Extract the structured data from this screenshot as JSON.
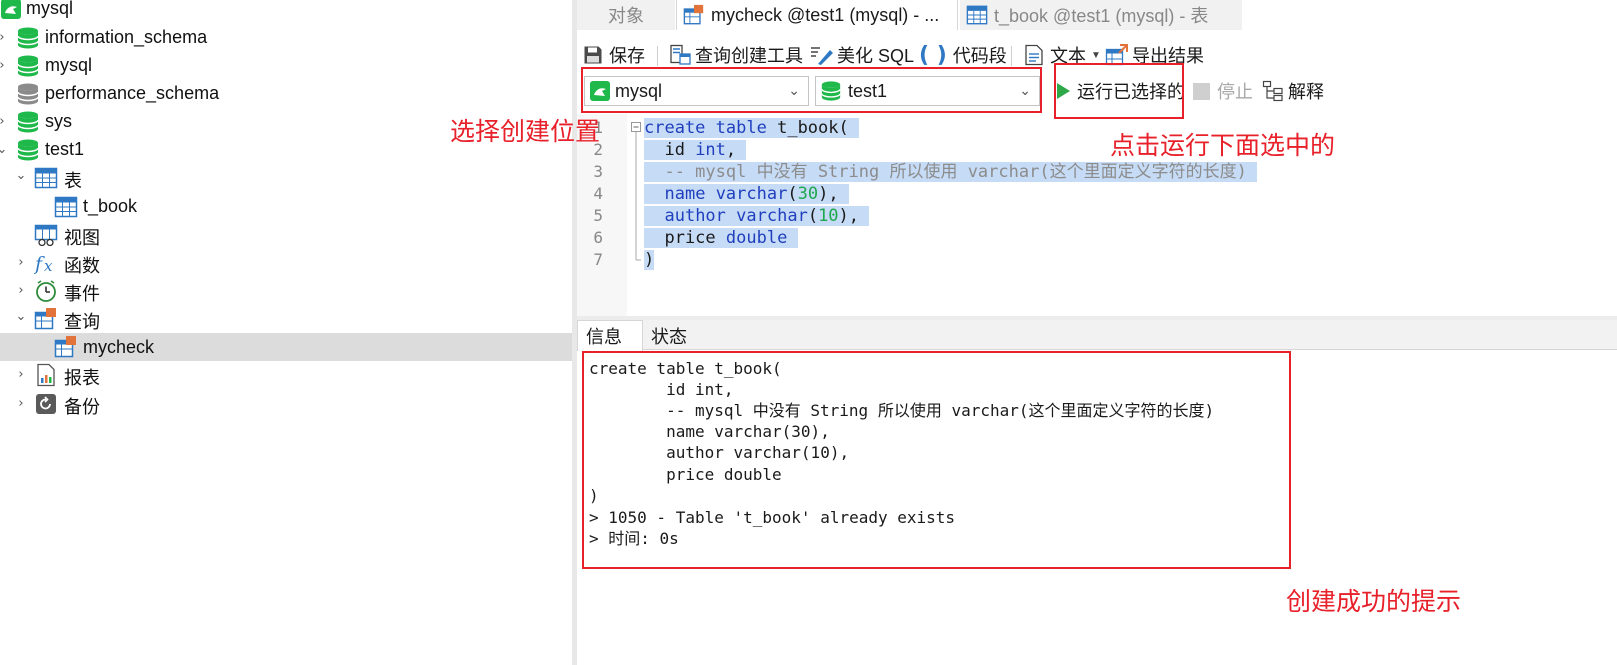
{
  "tree": {
    "items": [
      {
        "label": "mysql"
      },
      {
        "label": "information_schema"
      },
      {
        "label": "mysql"
      },
      {
        "label": "performance_schema"
      },
      {
        "label": "sys"
      },
      {
        "label": "test1"
      },
      {
        "label": "表"
      },
      {
        "label": "t_book"
      },
      {
        "label": "视图"
      },
      {
        "label": "函数"
      },
      {
        "label": "事件"
      },
      {
        "label": "查询"
      },
      {
        "label": "mycheck"
      },
      {
        "label": "报表"
      },
      {
        "label": "备份"
      }
    ]
  },
  "tabs": [
    {
      "label": "对象"
    },
    {
      "label": "mycheck @test1 (mysql) - ..."
    },
    {
      "label": "t_book @test1 (mysql) - 表"
    }
  ],
  "toolbar": {
    "save": "保存",
    "query_builder": "查询创建工具",
    "beautify": "美化 SQL",
    "snippet": "代码段",
    "text": "文本",
    "export": "导出结果"
  },
  "selectors": {
    "connection": "mysql",
    "database": "test1"
  },
  "actions": {
    "run_selected": "运行已选择的",
    "stop": "停止",
    "explain": "解释"
  },
  "editor": {
    "line_numbers": [
      "1",
      "2",
      "3",
      "4",
      "5",
      "6",
      "7"
    ],
    "lines": [
      "create table t_book(",
      "  id int,",
      "  -- mysql 中没有 String 所以使用 varchar(这个里面定义字符的长度)",
      "  name varchar(30),",
      "  author varchar(10),",
      "  price double",
      ")"
    ]
  },
  "result_tabs": [
    {
      "label": "信息"
    },
    {
      "label": "状态"
    }
  ],
  "output": {
    "lines": [
      "create table t_book(",
      "        id int,",
      "        -- mysql 中没有 String 所以使用 varchar(这个里面定义字符的长度)",
      "        name varchar(30),",
      "        author varchar(10),",
      "        price double",
      ")",
      "> 1050 - Table 't_book' already exists",
      "> 时间: 0s"
    ]
  },
  "annotations": {
    "select_location": "选择创建位置",
    "run_selected_hint": "点击运行下面选中的",
    "success_hint": "创建成功的提示"
  },
  "colors": {
    "annotation_red": "#e8202a",
    "db_green": "#1fb84a",
    "keyword_blue": "#1f3fbf",
    "number_green": "#1ea84e",
    "selection_blue": "#c6dbf5"
  }
}
